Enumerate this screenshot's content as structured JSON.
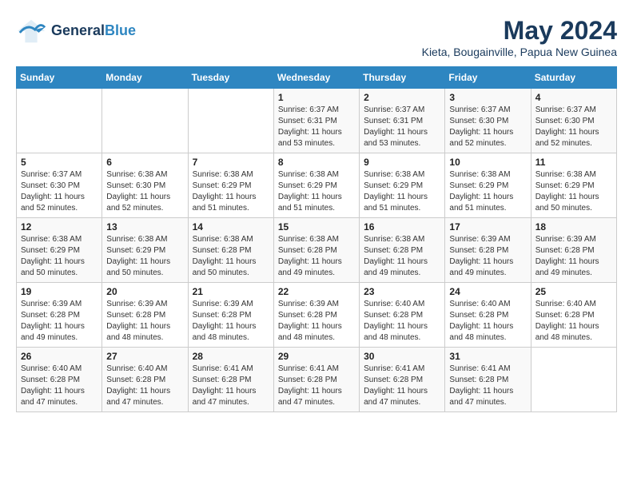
{
  "header": {
    "logo_line1": "General",
    "logo_line2": "Blue",
    "month_year": "May 2024",
    "location": "Kieta, Bougainville, Papua New Guinea"
  },
  "days_of_week": [
    "Sunday",
    "Monday",
    "Tuesday",
    "Wednesday",
    "Thursday",
    "Friday",
    "Saturday"
  ],
  "weeks": [
    [
      {
        "day": "",
        "info": ""
      },
      {
        "day": "",
        "info": ""
      },
      {
        "day": "",
        "info": ""
      },
      {
        "day": "1",
        "info": "Sunrise: 6:37 AM\nSunset: 6:31 PM\nDaylight: 11 hours and 53 minutes."
      },
      {
        "day": "2",
        "info": "Sunrise: 6:37 AM\nSunset: 6:31 PM\nDaylight: 11 hours and 53 minutes."
      },
      {
        "day": "3",
        "info": "Sunrise: 6:37 AM\nSunset: 6:30 PM\nDaylight: 11 hours and 52 minutes."
      },
      {
        "day": "4",
        "info": "Sunrise: 6:37 AM\nSunset: 6:30 PM\nDaylight: 11 hours and 52 minutes."
      }
    ],
    [
      {
        "day": "5",
        "info": "Sunrise: 6:37 AM\nSunset: 6:30 PM\nDaylight: 11 hours and 52 minutes."
      },
      {
        "day": "6",
        "info": "Sunrise: 6:38 AM\nSunset: 6:30 PM\nDaylight: 11 hours and 52 minutes."
      },
      {
        "day": "7",
        "info": "Sunrise: 6:38 AM\nSunset: 6:29 PM\nDaylight: 11 hours and 51 minutes."
      },
      {
        "day": "8",
        "info": "Sunrise: 6:38 AM\nSunset: 6:29 PM\nDaylight: 11 hours and 51 minutes."
      },
      {
        "day": "9",
        "info": "Sunrise: 6:38 AM\nSunset: 6:29 PM\nDaylight: 11 hours and 51 minutes."
      },
      {
        "day": "10",
        "info": "Sunrise: 6:38 AM\nSunset: 6:29 PM\nDaylight: 11 hours and 51 minutes."
      },
      {
        "day": "11",
        "info": "Sunrise: 6:38 AM\nSunset: 6:29 PM\nDaylight: 11 hours and 50 minutes."
      }
    ],
    [
      {
        "day": "12",
        "info": "Sunrise: 6:38 AM\nSunset: 6:29 PM\nDaylight: 11 hours and 50 minutes."
      },
      {
        "day": "13",
        "info": "Sunrise: 6:38 AM\nSunset: 6:29 PM\nDaylight: 11 hours and 50 minutes."
      },
      {
        "day": "14",
        "info": "Sunrise: 6:38 AM\nSunset: 6:28 PM\nDaylight: 11 hours and 50 minutes."
      },
      {
        "day": "15",
        "info": "Sunrise: 6:38 AM\nSunset: 6:28 PM\nDaylight: 11 hours and 49 minutes."
      },
      {
        "day": "16",
        "info": "Sunrise: 6:38 AM\nSunset: 6:28 PM\nDaylight: 11 hours and 49 minutes."
      },
      {
        "day": "17",
        "info": "Sunrise: 6:39 AM\nSunset: 6:28 PM\nDaylight: 11 hours and 49 minutes."
      },
      {
        "day": "18",
        "info": "Sunrise: 6:39 AM\nSunset: 6:28 PM\nDaylight: 11 hours and 49 minutes."
      }
    ],
    [
      {
        "day": "19",
        "info": "Sunrise: 6:39 AM\nSunset: 6:28 PM\nDaylight: 11 hours and 49 minutes."
      },
      {
        "day": "20",
        "info": "Sunrise: 6:39 AM\nSunset: 6:28 PM\nDaylight: 11 hours and 48 minutes."
      },
      {
        "day": "21",
        "info": "Sunrise: 6:39 AM\nSunset: 6:28 PM\nDaylight: 11 hours and 48 minutes."
      },
      {
        "day": "22",
        "info": "Sunrise: 6:39 AM\nSunset: 6:28 PM\nDaylight: 11 hours and 48 minutes."
      },
      {
        "day": "23",
        "info": "Sunrise: 6:40 AM\nSunset: 6:28 PM\nDaylight: 11 hours and 48 minutes."
      },
      {
        "day": "24",
        "info": "Sunrise: 6:40 AM\nSunset: 6:28 PM\nDaylight: 11 hours and 48 minutes."
      },
      {
        "day": "25",
        "info": "Sunrise: 6:40 AM\nSunset: 6:28 PM\nDaylight: 11 hours and 48 minutes."
      }
    ],
    [
      {
        "day": "26",
        "info": "Sunrise: 6:40 AM\nSunset: 6:28 PM\nDaylight: 11 hours and 47 minutes."
      },
      {
        "day": "27",
        "info": "Sunrise: 6:40 AM\nSunset: 6:28 PM\nDaylight: 11 hours and 47 minutes."
      },
      {
        "day": "28",
        "info": "Sunrise: 6:41 AM\nSunset: 6:28 PM\nDaylight: 11 hours and 47 minutes."
      },
      {
        "day": "29",
        "info": "Sunrise: 6:41 AM\nSunset: 6:28 PM\nDaylight: 11 hours and 47 minutes."
      },
      {
        "day": "30",
        "info": "Sunrise: 6:41 AM\nSunset: 6:28 PM\nDaylight: 11 hours and 47 minutes."
      },
      {
        "day": "31",
        "info": "Sunrise: 6:41 AM\nSunset: 6:28 PM\nDaylight: 11 hours and 47 minutes."
      },
      {
        "day": "",
        "info": ""
      }
    ]
  ]
}
